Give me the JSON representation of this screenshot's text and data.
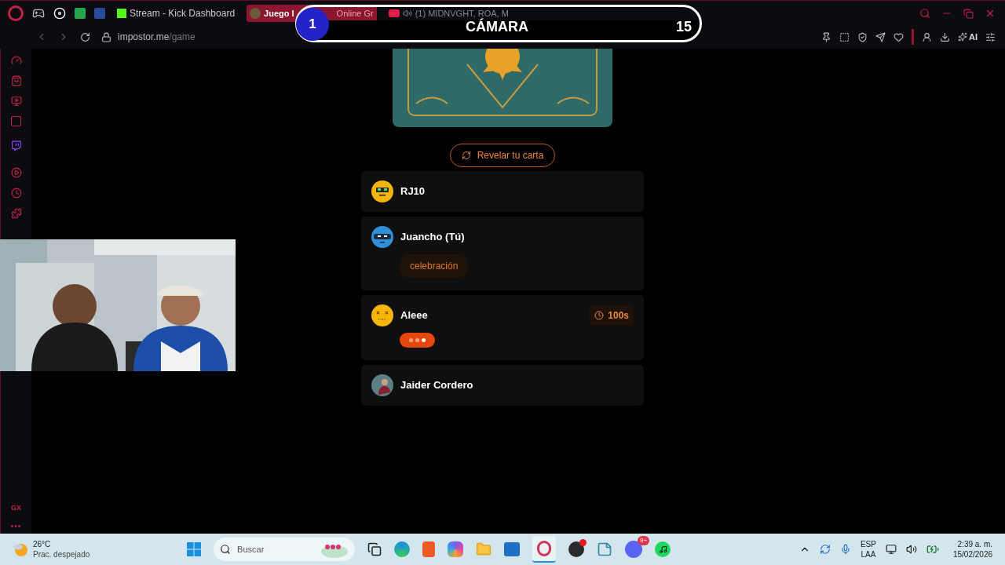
{
  "browser": {
    "tabs": [
      {
        "kind": "pinned",
        "title": "Stream - Kick Dashboard",
        "selected": false
      },
      {
        "kind": "split",
        "parts": [
          "Juego I",
          "Online Gr"
        ],
        "selected": true
      },
      {
        "kind": "media",
        "title": "(1) MIDNVGHT, ROA, M",
        "selected": false
      }
    ],
    "address": {
      "host": "impostor.me",
      "path": "/game"
    },
    "ai_label": "AI",
    "gx_label": "GX",
    "more_label": "•••"
  },
  "overlay": {
    "number": "1",
    "title": "CÁMARA",
    "count": "15"
  },
  "game": {
    "reveal_button": "Revelar tu carta",
    "players": [
      {
        "name": "RJ10",
        "kind": "robot",
        "color": "#f5b50a"
      },
      {
        "name": "Juancho (Tú)",
        "kind": "masked",
        "color": "#2f8fd8",
        "word": "celebración"
      },
      {
        "name": "Aleee",
        "kind": "dizzy",
        "color": "#f5b50a",
        "timer": "100s",
        "typing": true
      },
      {
        "name": "Jaider Cordero",
        "color": "#5d7f86"
      }
    ]
  },
  "taskbar": {
    "weather": {
      "temp": "26°C",
      "desc": "Prac. despejado"
    },
    "search_placeholder": "Buscar",
    "discord_badge": "9+",
    "lang": [
      "ESP",
      "LAA"
    ],
    "time": "2:39 a. m.",
    "date": "15/02/2026"
  }
}
